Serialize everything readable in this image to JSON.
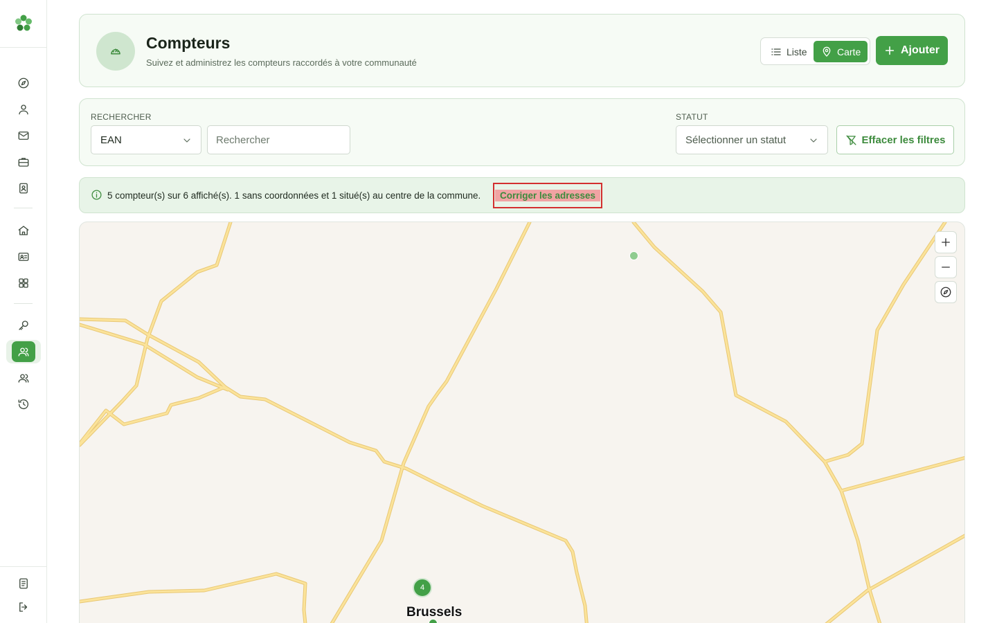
{
  "header": {
    "title": "Compteurs",
    "subtitle": "Suivez et administrez les compteurs raccordés à votre communauté",
    "view_list_label": "Liste",
    "view_map_label": "Carte",
    "add_label": "Ajouter"
  },
  "filters": {
    "search_label": "RECHERCHER",
    "field_value": "EAN",
    "search_placeholder": "Rechercher",
    "status_label": "STATUT",
    "status_placeholder": "Sélectionner un statut",
    "clear_label": "Effacer les filtres"
  },
  "banner": {
    "text": "5 compteur(s) sur 6 affiché(s). 1 sans coordonnées et 1 situé(s) au centre de la commune.",
    "fix_label": "Corriger les adresses"
  },
  "map": {
    "cluster_count": "4",
    "city_label": "Brussels",
    "controls": [
      "zoom-in",
      "zoom-out",
      "compass"
    ]
  },
  "sidebar": {
    "items": [
      "compass",
      "user",
      "mail",
      "briefcase",
      "contacts",
      "home",
      "id-card",
      "grid",
      "key",
      "users-active",
      "users",
      "history"
    ],
    "bottom": [
      "document",
      "logout"
    ]
  },
  "colors": {
    "accent": "#43a047",
    "accent_light": "#e8f4e8",
    "highlight_border": "#d32f2f",
    "highlight_bg": "#f1a3a3",
    "road": "#f9dd8e"
  }
}
